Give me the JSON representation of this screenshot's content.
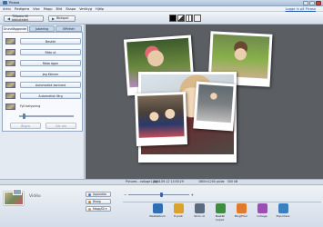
{
  "window": {
    "title": "Picasa"
  },
  "menu": {
    "items": [
      "Arkiv",
      "Redigera",
      "Visa",
      "Mapp",
      "Bild",
      "Skapa",
      "Verktyg",
      "Hjälp"
    ],
    "signin": "Logga in på Picasa"
  },
  "toolbar": {
    "back_label": "Tillbaka till biblioteket",
    "next_label": "Bildspel"
  },
  "left_panel": {
    "tabs": [
      "Grundläggande",
      "Justering",
      "Effekter"
    ],
    "effects": [
      "Beskär",
      "Räta ut",
      "Röda ögon",
      "Jag Känner",
      "Automatisk kontrast",
      "Automatisk färg",
      "Fyll belysning"
    ],
    "undo_label": "Ångra",
    "redo_label": "Gör om"
  },
  "status": {
    "file": "Pictures - collage1.jpg",
    "date": "2008-09-12 14:50:29",
    "resolution": "1600×1200 pixlar",
    "size": "500 kB"
  },
  "canvas": {
    "crop_hint": "Skapa en läckerhetsfilter"
  },
  "tray": {
    "label": "Vidéo",
    "buttons": [
      "Uppladda",
      "Bloog",
      "Mapp/ID ▾"
    ],
    "actions": [
      "Webbalbum",
      "E-post",
      "Skriv ut",
      "Beställ kopior",
      "BlogThis!",
      "Collage",
      "Exportera"
    ],
    "action_colors": [
      "#2f6db5",
      "#d9a22a",
      "#5a6b7d",
      "#3e8e41",
      "#e07a2c",
      "#9b4fb3",
      "#3a7fbf"
    ]
  }
}
